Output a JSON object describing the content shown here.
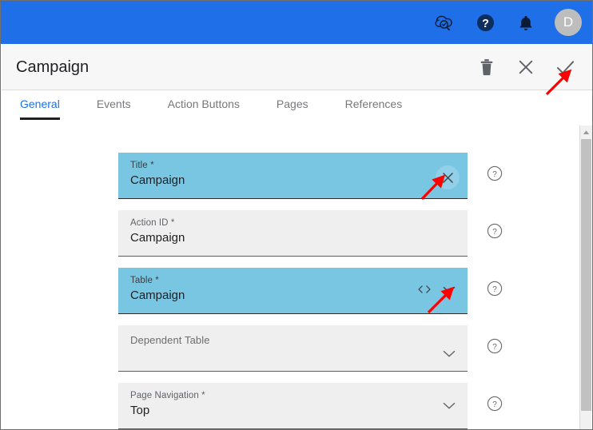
{
  "topbar": {
    "background_color": "#1E6FE8",
    "icons": [
      {
        "name": "cloud-search-check-icon",
        "label": "Cloud Search"
      },
      {
        "name": "help-circle-icon",
        "label": "Help"
      },
      {
        "name": "bell-icon",
        "label": "Notifications"
      }
    ],
    "avatar": {
      "initial": "D",
      "background_color": "#BDBDBD"
    }
  },
  "page_header": {
    "title": "Campaign",
    "actions": [
      {
        "name": "delete-button",
        "label": "Delete"
      },
      {
        "name": "close-button",
        "label": "Close"
      },
      {
        "name": "confirm-button",
        "label": "Confirm"
      }
    ]
  },
  "tabs": {
    "active_color": "#1A73E8",
    "items": [
      {
        "label": "General",
        "active": true
      },
      {
        "label": "Events",
        "active": false
      },
      {
        "label": "Action Buttons",
        "active": false
      },
      {
        "label": "Pages",
        "active": false
      },
      {
        "label": "References",
        "active": false
      }
    ]
  },
  "form": {
    "highlight_color": "#79C6E3",
    "fields": [
      {
        "label": "Title *",
        "value": "Campaign",
        "placeholder": "Title",
        "highlighted": true,
        "icons": [
          "clear-icon"
        ]
      },
      {
        "label": "Action ID *",
        "value": "Campaign",
        "placeholder": "Action ID",
        "highlighted": false,
        "icons": []
      },
      {
        "label": "Table *",
        "value": "Campaign",
        "placeholder": "Table",
        "highlighted": true,
        "icons": [
          "code-icon",
          "chevron-down-icon"
        ]
      },
      {
        "label": "Dependent Table",
        "value": "",
        "placeholder": "Dependent Table",
        "highlighted": false,
        "icons": [
          "chevron-down-icon"
        ]
      },
      {
        "label": "Page Navigation *",
        "value": "Top",
        "placeholder": "Page Navigation",
        "highlighted": false,
        "icons": [
          "chevron-down-icon"
        ]
      }
    ],
    "help_tooltip": "?"
  },
  "scrollbar": {
    "name": "vertical-scrollbar",
    "up_arrow": "scroll-up-arrow",
    "thumb": "scroll-thumb"
  },
  "annotations": [
    {
      "name": "arrow-to-confirm-button",
      "color": "#FF0000"
    },
    {
      "name": "arrow-to-title-clear-icon",
      "color": "#FF0000"
    },
    {
      "name": "arrow-to-table-dropdown-icon",
      "color": "#FF0000"
    }
  ]
}
